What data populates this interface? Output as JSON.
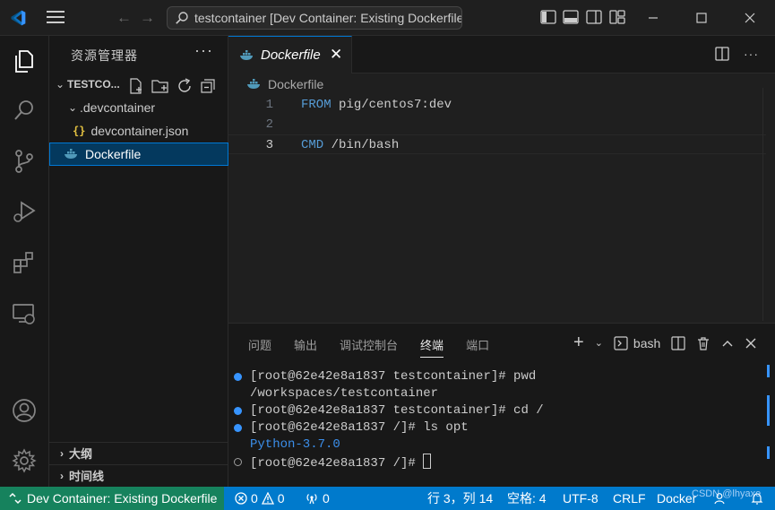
{
  "titlebar": {
    "search_text": "testcontainer [Dev Container: Existing Dockerfile]"
  },
  "sidebar": {
    "title": "资源管理器",
    "more": "···",
    "root_folder": "TESTCO...",
    "items": [
      {
        "label": ".devcontainer"
      },
      {
        "label": "devcontainer.json",
        "icon_text": "{}"
      },
      {
        "label": "Dockerfile"
      }
    ],
    "sections": [
      {
        "label": "大纲"
      },
      {
        "label": "时间线"
      }
    ]
  },
  "editor": {
    "tab_label": "Dockerfile",
    "tab_close": "✕",
    "breadcrumb": "Dockerfile",
    "lines": [
      {
        "num": "1",
        "keyword": "FROM",
        "rest": " pig/centos7:dev"
      },
      {
        "num": "2",
        "keyword": "",
        "rest": ""
      },
      {
        "num": "3",
        "keyword": "CMD",
        "rest": " /bin/bash"
      }
    ]
  },
  "panel": {
    "tabs": [
      "问题",
      "输出",
      "调试控制台",
      "终端",
      "端口"
    ],
    "active_tab": "终端",
    "shell_label": "bash",
    "terminal": {
      "line1": "[root@62e42e8a1837 testcontainer]# pwd",
      "line2": "/workspaces/testcontainer",
      "line3": "[root@62e42e8a1837 testcontainer]# cd /",
      "line4": "[root@62e42e8a1837 /]# ls opt",
      "line5": "Python-3.7.0",
      "line6": "[root@62e42e8a1837 /]# "
    }
  },
  "statusbar": {
    "remote": "Dev Container: Existing Dockerfile",
    "errors": "0",
    "warnings": "0",
    "ports": "0",
    "position": "行 3，列 14",
    "spaces": "空格: 4",
    "encoding": "UTF-8",
    "eol": "CRLF",
    "language": "Docker"
  },
  "watermark": "CSDN @lhyaxe",
  "colors": {
    "accent": "#0078d4",
    "statusbar": "#007acc",
    "remote": "#16825d",
    "keyword": "#569cd6",
    "terminal_blue": "#3b8eea"
  }
}
